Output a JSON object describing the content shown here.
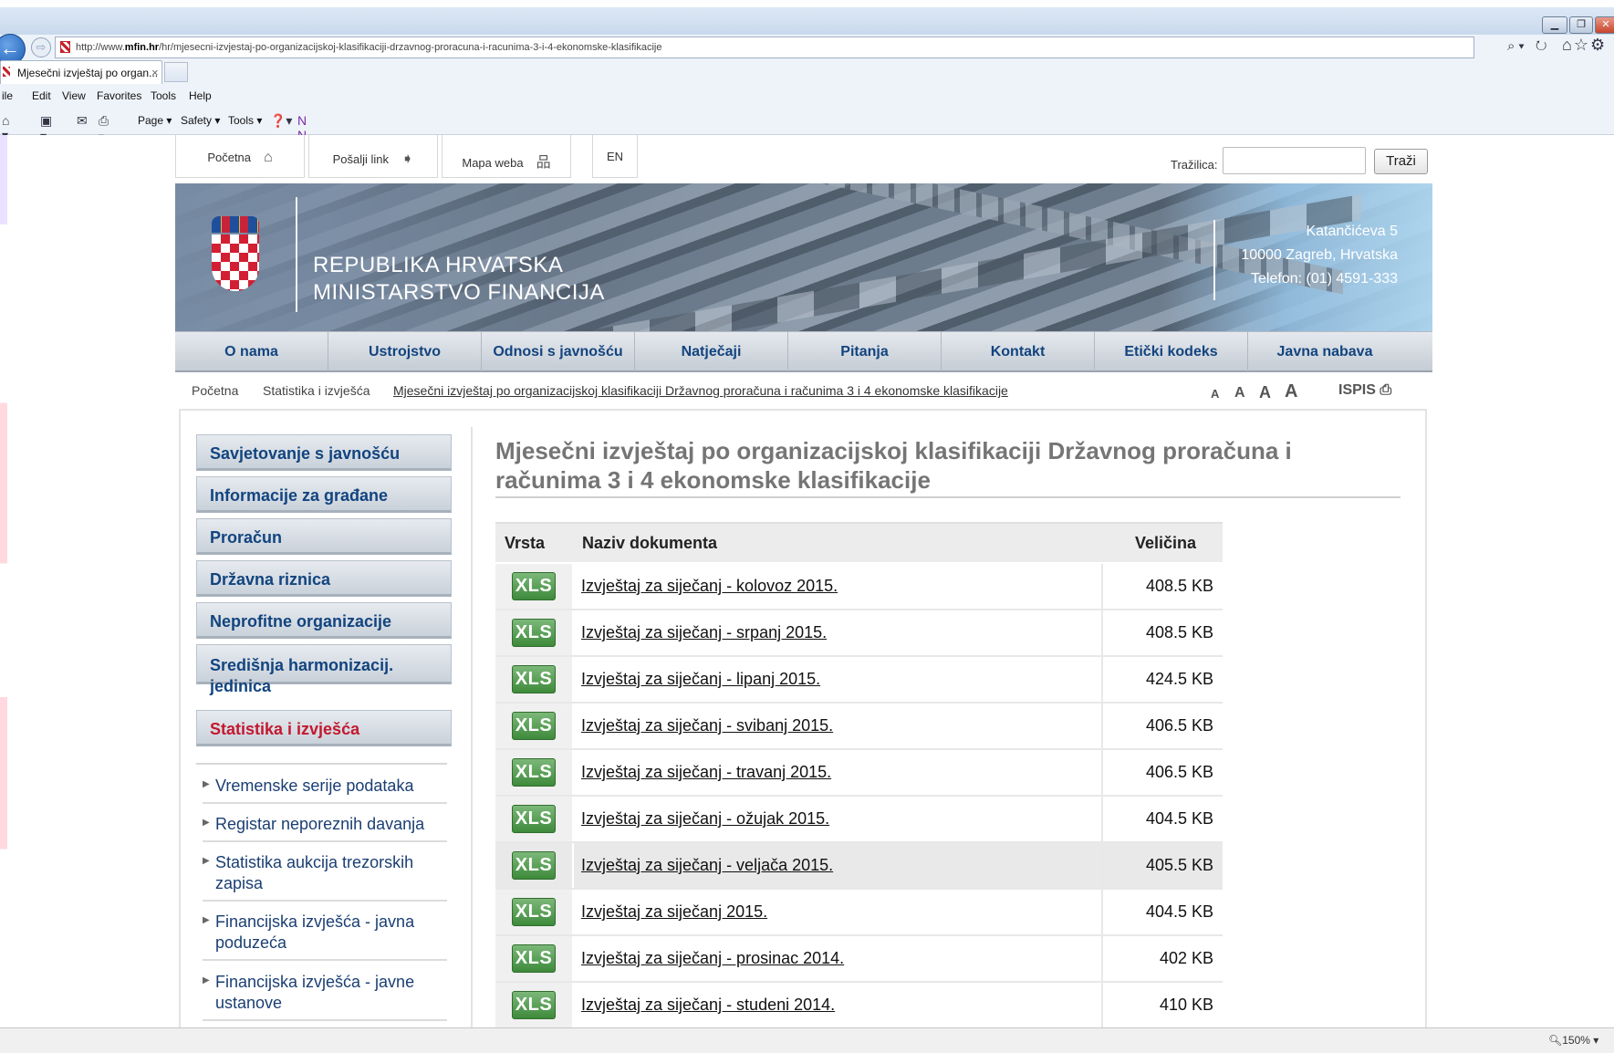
{
  "browser": {
    "url_prefix": "http://www.",
    "url_domain": "mfin.hr",
    "url_path": "/hr/mjesecni-izvjestaj-po-organizacijskoj-klasifikaciji-drzavnog-proracuna-i-racunima-3-i-4-ekonomske-klasifikacije",
    "tab_title": "Mjesečni izvještaj po organ...",
    "tab_close": "×",
    "menu": [
      "ile",
      "Edit",
      "View",
      "Favorites",
      "Tools",
      "Help"
    ],
    "commands": [
      "Page ▾",
      "Safety ▾",
      "Tools ▾"
    ],
    "zoom": "150%",
    "address_icons": "⌕▾ ↻",
    "right_icons": "⌂☆⚙"
  },
  "utility": {
    "home_label": "Početna",
    "send_link_label": "Pošalji link",
    "sitemap_label": "Mapa weba",
    "lang_label": "EN",
    "search_label": "Tražilica:",
    "search_placeholder": "",
    "search_button": "Traži"
  },
  "banner": {
    "line1": "REPUBLIKA HRVATSKA",
    "line2": "MINISTARSTVO FINANCIJA",
    "address1": "Katančićeva 5",
    "address2": "10000 Zagreb, Hrvatska",
    "address3": "Telefon: (01) 4591-333"
  },
  "nav": [
    "O nama",
    "Ustrojstvo",
    "Odnosi s javnošću",
    "Natječaji",
    "Pitanja",
    "Kontakt",
    "Etički kodeks",
    "Javna nabava"
  ],
  "breadcrumb": {
    "home": "Početna",
    "section": "Statistika i izvješća",
    "current": "Mjesečni izvještaj po organizacijskoj klasifikaciji Državnog proračuna i računima 3 i 4 ekonomske klasifikacije"
  },
  "font_sizes": [
    "A",
    "A",
    "A",
    "A"
  ],
  "print_label": "ISPIS",
  "sidebar": {
    "items": [
      "Savjetovanje s javnošću",
      "Informacije za građane",
      "Proračun",
      "Državna riznica",
      "Neprofitne organizacije",
      "Središnja harmonizacij. jedinica",
      "Statistika i izvješća"
    ],
    "active_color": "#c4182f",
    "subitems": [
      "Vremenske serije podataka",
      "Registar neporeznih davanja",
      "Statistika aukcija trezorskih zapisa",
      "Financijska izvješća - javna poduzeća",
      "Financijska izvješća - javne ustanove"
    ]
  },
  "main": {
    "title": "Mjesečni izvještaj po organizacijskoj klasifikaciji Državnog proračuna i računima 3 i 4 ekonomske klasifikacije",
    "table_headers": {
      "type": "Vrsta",
      "name": "Naziv dokumenta",
      "size": "Veličina"
    },
    "documents": [
      {
        "type": "XLS",
        "name": "Izvještaj za siječanj - kolovoz 2015.",
        "size": "408.5 KB"
      },
      {
        "type": "XLS",
        "name": "Izvještaj za siječanj - srpanj 2015.",
        "size": "408.5 KB"
      },
      {
        "type": "XLS",
        "name": "Izvještaj za siječanj - lipanj 2015.",
        "size": "424.5 KB"
      },
      {
        "type": "XLS",
        "name": "Izvještaj za siječanj - svibanj 2015.",
        "size": "406.5 KB"
      },
      {
        "type": "XLS",
        "name": "Izvještaj za siječanj - travanj 2015.",
        "size": "406.5 KB"
      },
      {
        "type": "XLS",
        "name": "Izvještaj za siječanj - ožujak 2015.",
        "size": "404.5 KB"
      },
      {
        "type": "XLS",
        "name": "Izvještaj za siječanj - veljača 2015.",
        "size": "405.5 KB"
      },
      {
        "type": "XLS",
        "name": "Izvještaj za siječanj 2015.",
        "size": "404.5 KB"
      },
      {
        "type": "XLS",
        "name": "Izvještaj za siječanj - prosinac 2014.",
        "size": "402 KB"
      },
      {
        "type": "XLS",
        "name": "Izvještaj za siječanj - studeni 2014.",
        "size": "410 KB"
      }
    ],
    "highlight_row": 6
  }
}
